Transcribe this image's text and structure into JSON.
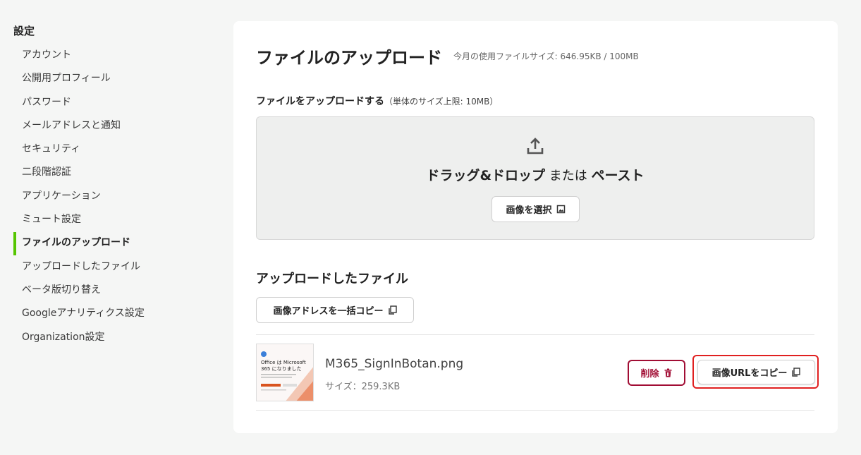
{
  "sidebar": {
    "title": "設定",
    "items": [
      {
        "label": "アカウント"
      },
      {
        "label": "公開用プロフィール"
      },
      {
        "label": "パスワード"
      },
      {
        "label": "メールアドレスと通知"
      },
      {
        "label": "セキュリティ"
      },
      {
        "label": "二段階認証"
      },
      {
        "label": "アプリケーション"
      },
      {
        "label": "ミュート設定"
      },
      {
        "label": "ファイルのアップロード",
        "active": true
      },
      {
        "label": "アップロードしたファイル"
      },
      {
        "label": "ベータ版切り替え"
      },
      {
        "label": "Googleアナリティクス設定"
      },
      {
        "label": "Organization設定"
      }
    ],
    "accent": "#55c500"
  },
  "main": {
    "title": "ファイルのアップロード",
    "usage": "今月の使用ファイルサイズ: 646.95KB / 100MB",
    "upload": {
      "label": "ファイルをアップロードする",
      "limit": "（単体のサイズ上限: 10MB）",
      "drag_text": "ドラッグ&ドロップ",
      "or_text": " または ",
      "paste_text": "ペースト",
      "select_button": "画像を選択"
    },
    "uploaded": {
      "title": "アップロードしたファイル",
      "copy_all_button": "画像アドレスを一括コピー",
      "files": [
        {
          "name": "M365_SignInBotan.png",
          "size": "サイズ：259.3KB",
          "thumb_text_1": "Office は Microsoft",
          "thumb_text_2": "365 になりました",
          "delete_button": "削除",
          "copy_url_button": "画像URLをコピー"
        }
      ]
    },
    "colors": {
      "delete": "#a10d34",
      "highlight": "#e02020"
    }
  }
}
